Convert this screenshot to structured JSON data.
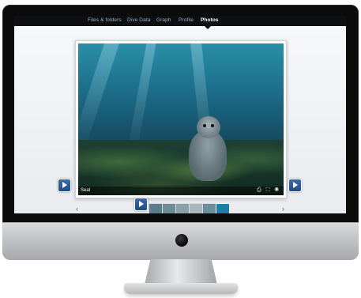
{
  "nav": {
    "items": [
      {
        "label": "Files & folders"
      },
      {
        "label": "Dive Data"
      },
      {
        "label": "Graph"
      },
      {
        "label": "Profile"
      },
      {
        "label": "Photos",
        "active": true
      }
    ]
  },
  "viewer": {
    "caption": "Seal",
    "tools": [
      "share-icon",
      "fullscreen-icon",
      "view-icon"
    ],
    "tool_glyphs": "⎙ ⛶ ◉"
  },
  "thumbnails": {
    "count": 6,
    "selected_index": 5,
    "colors": [
      "#5d7d8a",
      "#6f8c96",
      "#8aa1a8",
      "#a7b6ba",
      "#6d8f99",
      "#1d7fa6"
    ]
  },
  "colors": {
    "nav_bg": "#0d0f12",
    "nav_text": "#9ab3c9",
    "accent_button": "#2a5a98"
  }
}
